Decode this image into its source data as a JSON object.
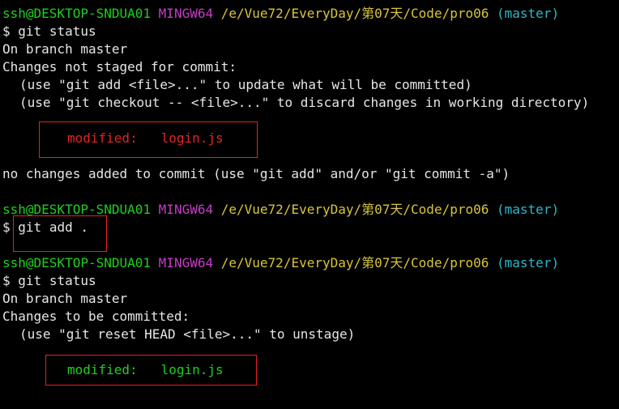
{
  "prompt": {
    "user_host": "ssh@DESKTOP-SNDUA01",
    "shell": "MINGW64",
    "path": "/e/Vue72/EveryDay/第07天/Code/pro06",
    "branch": "(master)",
    "symbol": "$"
  },
  "block1": {
    "command": "git status",
    "on_branch": "On branch master",
    "header": "Changes not staged for commit:",
    "hint1": "(use \"git add <file>...\" to update what will be committed)",
    "hint2": "(use \"git checkout -- <file>...\" to discard changes in working directory)",
    "status": "modified:",
    "file": "login.js",
    "footer": "no changes added to commit (use \"git add\" and/or \"git commit -a\")"
  },
  "block2": {
    "command": "git add ."
  },
  "block3": {
    "command": "git status",
    "on_branch": "On branch master",
    "header": "Changes to be committed:",
    "hint1": "(use \"git reset HEAD <file>...\" to unstage)",
    "status": "modified:",
    "file": "login.js"
  },
  "colors": {
    "background": "#000000",
    "user_host": "#1fcf1f",
    "shell": "#c53cc5",
    "path": "#d9c43a",
    "branch": "#2eb8c8",
    "unstaged": "#e52222",
    "staged": "#1fcf1f",
    "highlight_box": "#e52222"
  }
}
